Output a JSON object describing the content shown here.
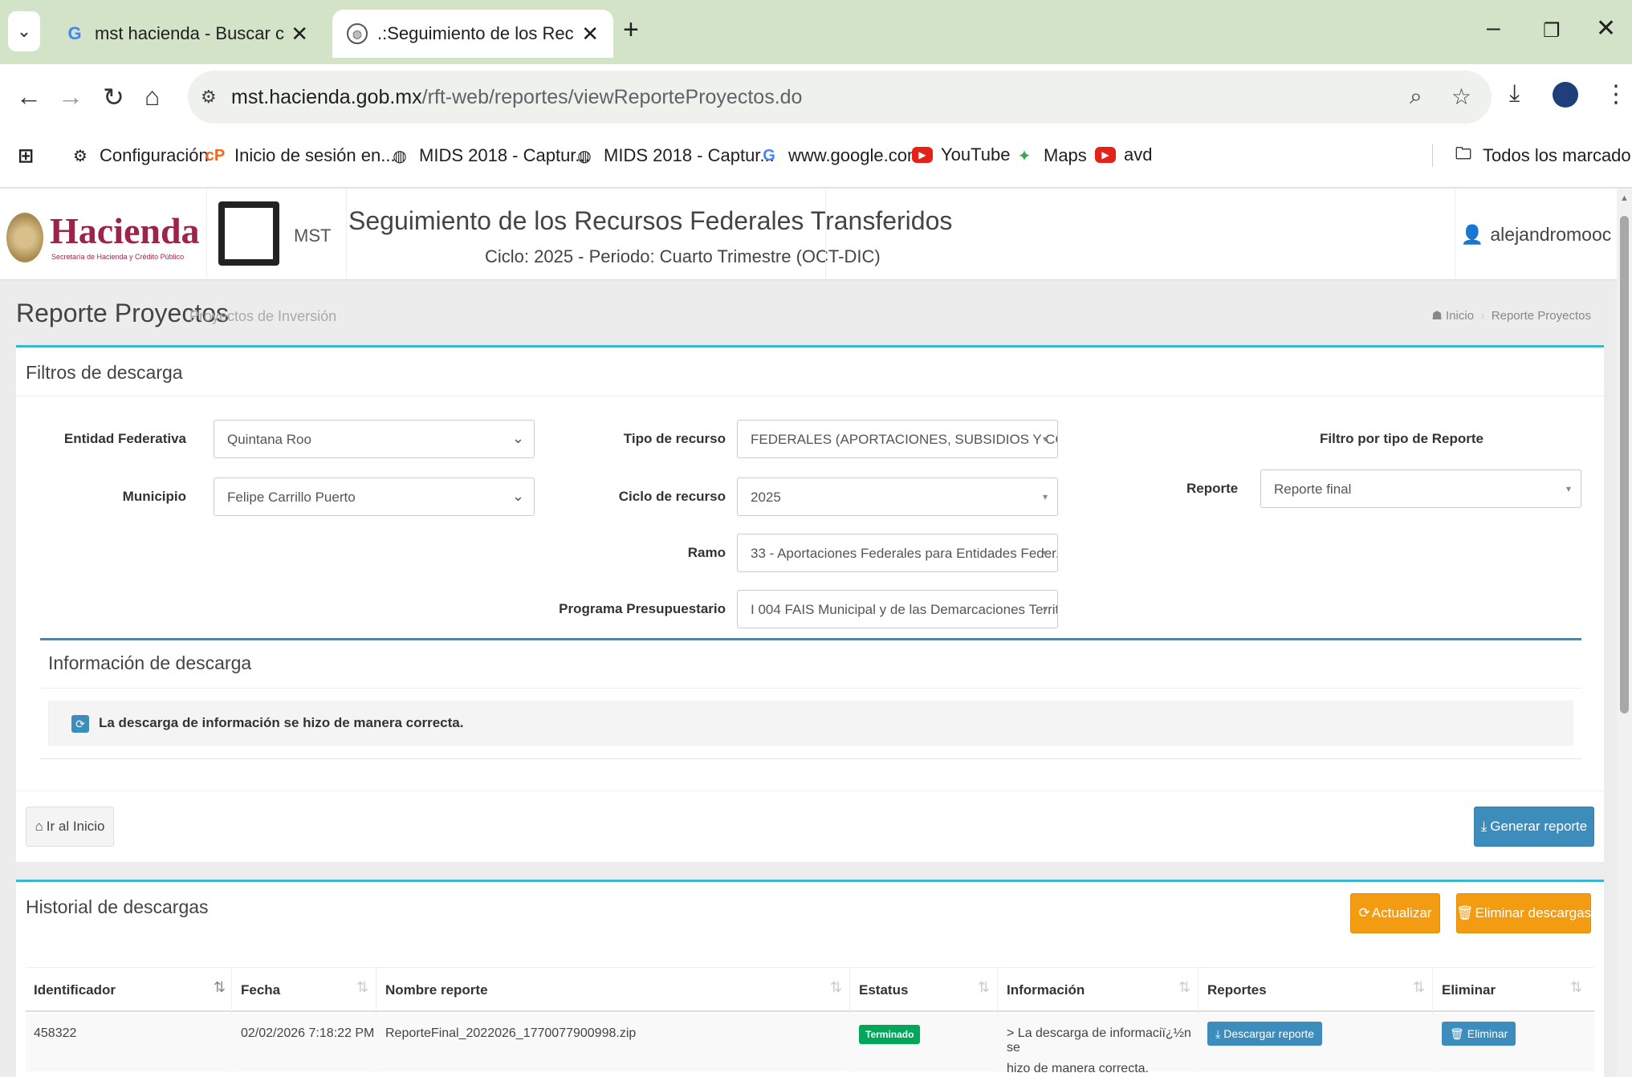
{
  "browser": {
    "tabs": [
      {
        "title": "mst hacienda - Buscar con Goo",
        "icon": "google-icon",
        "active": false
      },
      {
        "title": ".:Seguimiento de los Recursos F",
        "icon": "globe-icon",
        "active": true
      }
    ],
    "url_host": "mst.hacienda.gob.mx",
    "url_path": "/rft-web/reportes/viewReporteProyectos.do",
    "bookmarks": [
      {
        "label": "Configuración",
        "icon": "gear-icon"
      },
      {
        "label": "Inicio de sesión en...",
        "icon": "cp-icon"
      },
      {
        "label": "MIDS 2018 - Captur...",
        "icon": "globe-icon"
      },
      {
        "label": "MIDS 2018 - Captur...",
        "icon": "globe-icon"
      },
      {
        "label": "www.google.com",
        "icon": "google-icon"
      },
      {
        "label": "YouTube",
        "icon": "youtube-icon"
      },
      {
        "label": "Maps",
        "icon": "maps-icon"
      },
      {
        "label": "avd",
        "icon": "youtube-icon"
      }
    ],
    "all_bookmarks": "Todos los marcadores"
  },
  "header": {
    "brand": "Hacienda",
    "brand_sub": "Secretaría de Hacienda y Crédito Público",
    "mst": "MST",
    "title": "Seguimiento de los Recursos Federales Transferidos",
    "subtitle": "Ciclo: 2025 - Periodo: Cuarto Trimestre (OCT-DIC)",
    "user": "alejandromooc"
  },
  "page": {
    "title": "Reporte Proyectos",
    "subtitle": "Proyectos de Inversión",
    "breadcrumb_home": "Inicio",
    "breadcrumb_current": "Reporte Proyectos"
  },
  "filtros": {
    "title": "Filtros de descarga",
    "entidad_label": "Entidad Federativa",
    "entidad_value": "Quintana Roo",
    "municipio_label": "Municipio",
    "municipio_value": "Felipe Carrillo Puerto",
    "tipo_label": "Tipo de recurso",
    "tipo_value": "FEDERALES (APORTACIONES, SUBSIDIOS Y CONVE...",
    "ciclo_label": "Ciclo de recurso",
    "ciclo_value": "2025",
    "ramo_label": "Ramo",
    "ramo_value": "33 - Aportaciones Federales para Entidades Feder...",
    "programa_label": "Programa Presupuestario",
    "programa_value": "I 004 FAIS Municipal y de las Demarcaciones Territ...",
    "filtro_tipo_title": "Filtro por tipo de Reporte",
    "reporte_label": "Reporte",
    "reporte_value": "Reporte final"
  },
  "info": {
    "title": "Información de descarga",
    "message": "La descarga de información se hizo de manera correcta."
  },
  "actions": {
    "inicio": "Ir al Inicio",
    "generar": "Generar reporte"
  },
  "historial": {
    "title": "Historial de descargas",
    "actualizar": "Actualizar",
    "eliminar_descargas": "Eliminar descargas",
    "columns": [
      "Identificador",
      "Fecha",
      "Nombre reporte",
      "Estatus",
      "Información",
      "Reportes",
      "Eliminar"
    ],
    "rows": [
      {
        "id": "458322",
        "fecha": "02/02/2026 7:18:22 PM",
        "nombre": "ReporteFinal_2022026_1770077900998.zip",
        "estatus": "Terminado",
        "info_line1": "> La descarga de informaciï¿½n se",
        "info_line2": "hizo de manera correcta.",
        "descargar": "Descargar reporte",
        "eliminar": "Eliminar"
      }
    ]
  },
  "colors": {
    "accent": "#3cb6ce",
    "primary": "#3c8dbc",
    "warning": "#f39c12",
    "success": "#00a65a",
    "brand": "#9d2449"
  }
}
